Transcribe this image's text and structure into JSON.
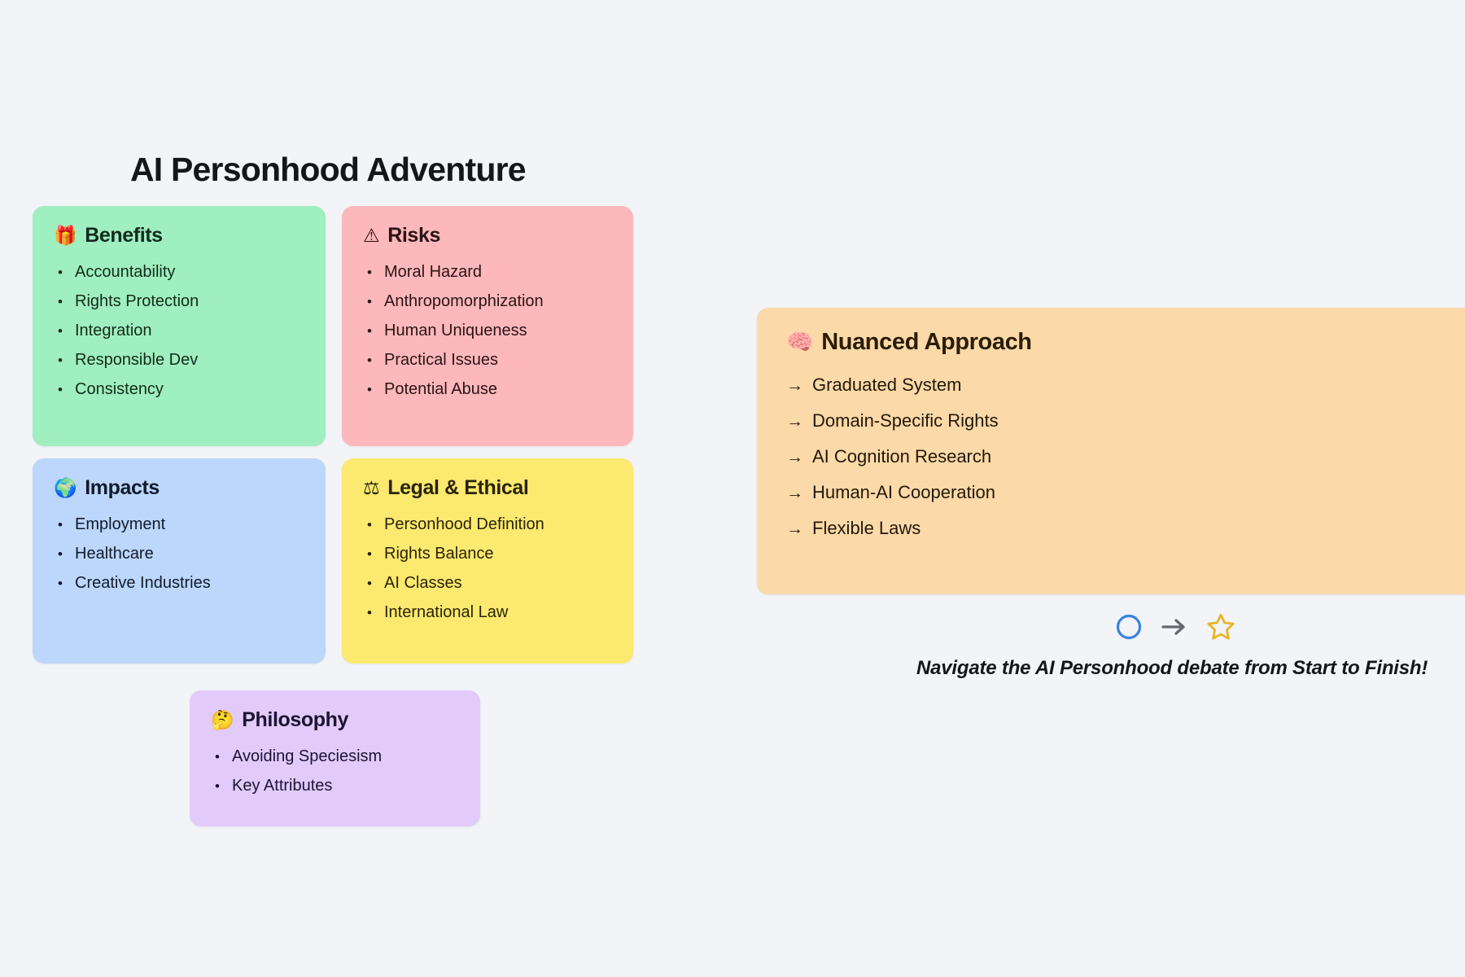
{
  "page": {
    "title": "AI Personhood Adventure",
    "background_color": "#f2f4f7"
  },
  "cards": [
    {
      "id": "benefits",
      "emoji": "🎁",
      "icon_name": "gift-emoji",
      "title": "Benefits",
      "color": "#9fefc0",
      "bullet": "•",
      "items": [
        "Accountability",
        "Rights Protection",
        "Integration",
        "Responsible Dev",
        "Consistency"
      ]
    },
    {
      "id": "risks",
      "emoji": "⚠",
      "icon_name": "warning-triangle-icon",
      "title": "Risks",
      "color": "#fcb8bb",
      "bullet": "•",
      "items": [
        "Moral Hazard",
        "Anthropomorphization",
        "Human Uniqueness",
        "Practical Issues",
        "Potential Abuse"
      ]
    },
    {
      "id": "impacts",
      "emoji": "🌍",
      "icon_name": "globe-emoji",
      "title": "Impacts",
      "color": "#bcd7fb",
      "bullet": "•",
      "items": [
        "Employment",
        "Healthcare",
        "Creative Industries"
      ]
    },
    {
      "id": "legal",
      "emoji": "⚖",
      "icon_name": "scales-of-justice-emoji",
      "title": "Legal & Ethical",
      "color": "#fce96f",
      "bullet": "•",
      "items": [
        "Personhood Definition",
        "Rights Balance",
        "AI Classes",
        "International Law"
      ]
    },
    {
      "id": "philosophy",
      "emoji": "🤔",
      "icon_name": "thinking-face-emoji",
      "title": "Philosophy",
      "color": "#e2cbfb",
      "bullet": "•",
      "items": [
        "Avoiding Speciesism",
        "Key Attributes"
      ]
    }
  ],
  "nuanced": {
    "emoji": "🧠",
    "icon_name": "brain-emoji",
    "title": "Nuanced Approach",
    "color": "#fcd9a8",
    "arrow": "→",
    "items": [
      "Graduated System",
      "Domain-Specific Rights",
      "AI Cognition Research",
      "Human-AI Cooperation",
      "Flexible Laws"
    ]
  },
  "footer": {
    "start_icon": "circle-outline-icon",
    "start_icon_color": "#3b82e0",
    "arrow_icon": "arrow-right-icon",
    "arrow_icon_color": "#62686f",
    "finish_icon": "star-outline-icon",
    "finish_icon_color": "#e8b525",
    "caption": "Navigate the AI Personhood debate from Start to Finish!"
  }
}
